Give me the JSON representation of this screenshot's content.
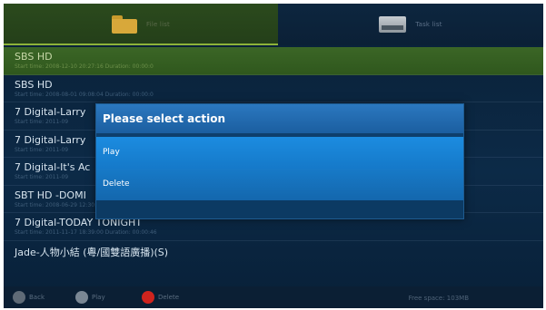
{
  "tabs": [
    {
      "label": "File list",
      "icon": "folder-icon",
      "active": true
    },
    {
      "label": "Task list",
      "icon": "task-list-icon",
      "active": false
    }
  ],
  "recordings": [
    {
      "title": "SBS HD",
      "meta": "Start time: 2008-12-10 20:27:16    Duration: 00:00:0"
    },
    {
      "title": "SBS HD",
      "meta": "Start time: 2008-08-01 09:08:04    Duration: 00:00:0"
    },
    {
      "title": "7 Digital-Larry",
      "meta": "Start time: 2011-09"
    },
    {
      "title": "7 Digital-Larry",
      "meta": "Start time: 2011-09"
    },
    {
      "title": "7 Digital-It's Ac",
      "meta": "Start time: 2011-09"
    },
    {
      "title": "SBT HD -DOMI",
      "meta": "Start time: 2008-06-29 12:30:48    Duration: 00:00:16"
    },
    {
      "title": "7 Digital-TODAY TONIGHT",
      "meta": "Start time: 2011-11-17 18:39:00    Duration: 00:00:46"
    },
    {
      "title": "Jade-人物小結 (粵/國雙語廣播)(S)",
      "meta": ""
    }
  ],
  "bottom": {
    "ok_label": "Back",
    "play_label": "Play",
    "delete_label": "Delete",
    "free_space": "Free space: 103MB"
  },
  "dialog": {
    "title": "Please select action",
    "options": [
      "Play",
      "Delete"
    ]
  },
  "colors": {
    "selected_row": "#3b6626",
    "dialog_header": "#2b78c0",
    "dialog_option": "#1c8ce0",
    "delete_button": "#d0241e"
  }
}
